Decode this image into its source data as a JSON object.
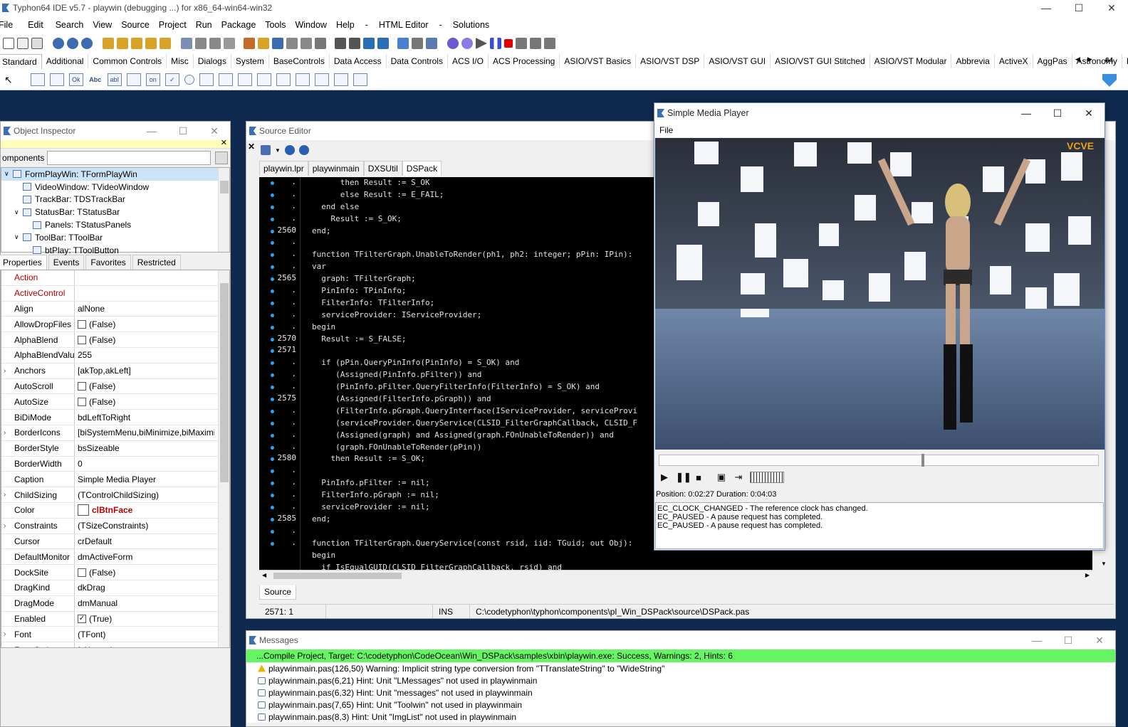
{
  "ide": {
    "title": "Typhon64 IDE v5.7 - playwin (debugging ...) for x86_64-win64-win32",
    "menu": [
      "File",
      "Edit",
      "Search",
      "View",
      "Source",
      "Project",
      "Run",
      "Package",
      "Tools",
      "Window",
      "Help",
      "-",
      "HTML Editor",
      "-",
      "Solutions"
    ],
    "component_tabs": [
      "Standard",
      "Additional",
      "Common Controls",
      "Misc",
      "Dialogs",
      "System",
      "BaseControls",
      "Data Access",
      "Data Controls",
      "ACS I/O",
      "ACS Processing",
      "ASIO/VST Basics",
      "ASIO/VST DSP",
      "ASIO/VST GUI",
      "ASIO/VST GUI Stitched",
      "ASIO/VST Modular",
      "Abbrevia",
      "ActiveX",
      "AggPas",
      "Astronomy",
      "B"
    ],
    "badge": "64",
    "palette_icons": [
      "Ok",
      "Abc",
      "abI",
      "on"
    ]
  },
  "object_inspector": {
    "title": "Object Inspector",
    "filter_label": "omponents",
    "tree": [
      {
        "label": "FormPlayWin: TFormPlayWin",
        "indent": 0,
        "expanded": "v"
      },
      {
        "label": "VideoWindow: TVideoWindow",
        "indent": 1,
        "expanded": ""
      },
      {
        "label": "TrackBar: TDSTrackBar",
        "indent": 1,
        "expanded": ""
      },
      {
        "label": "StatusBar: TStatusBar",
        "indent": 1,
        "expanded": "v"
      },
      {
        "label": "Panels: TStatusPanels",
        "indent": 2,
        "expanded": ""
      },
      {
        "label": "ToolBar: TToolBar",
        "indent": 1,
        "expanded": "v"
      },
      {
        "label": "btPlay: TToolButton",
        "indent": 2,
        "expanded": ""
      }
    ],
    "tabs": [
      "Properties",
      "Events",
      "Favorites",
      "Restricted"
    ],
    "properties": [
      {
        "name": "Action",
        "value": "",
        "red": true
      },
      {
        "name": "ActiveControl",
        "value": "",
        "red": true
      },
      {
        "name": "Align",
        "value": "alNone"
      },
      {
        "name": "AllowDropFiles",
        "value": "(False)",
        "checkbox": "unchecked"
      },
      {
        "name": "AlphaBlend",
        "value": "(False)",
        "checkbox": "unchecked"
      },
      {
        "name": "AlphaBlendValu",
        "value": "255"
      },
      {
        "name": "Anchors",
        "value": "[akTop,akLeft]",
        "expandable": true
      },
      {
        "name": "AutoScroll",
        "value": "(False)",
        "checkbox": "unchecked"
      },
      {
        "name": "AutoSize",
        "value": "(False)",
        "checkbox": "unchecked"
      },
      {
        "name": "BiDiMode",
        "value": "bdLeftToRight"
      },
      {
        "name": "BorderIcons",
        "value": "[biSystemMenu,biMinimize,biMaximi",
        "expandable": true
      },
      {
        "name": "BorderStyle",
        "value": "bsSizeable"
      },
      {
        "name": "BorderWidth",
        "value": "0"
      },
      {
        "name": "Caption",
        "value": "Simple Media Player"
      },
      {
        "name": "ChildSizing",
        "value": "(TControlChildSizing)",
        "expandable": true
      },
      {
        "name": "Color",
        "value": "clBtnFace",
        "swatch": true
      },
      {
        "name": "Constraints",
        "value": "(TSizeConstraints)",
        "expandable": true
      },
      {
        "name": "Cursor",
        "value": "crDefault"
      },
      {
        "name": "DefaultMonitor",
        "value": "dmActiveForm"
      },
      {
        "name": "DockSite",
        "value": "(False)",
        "checkbox": "unchecked"
      },
      {
        "name": "DragKind",
        "value": "dkDrag"
      },
      {
        "name": "DragMode",
        "value": "dmManual"
      },
      {
        "name": "Enabled",
        "value": "(True)",
        "checkbox": "checked"
      },
      {
        "name": "Font",
        "value": "(TFont)",
        "expandable": true
      },
      {
        "name": "FormStyle",
        "value": "fsNormal"
      }
    ]
  },
  "source_editor": {
    "title": "Source Editor",
    "tabs": [
      "playwin.lpr",
      "playwinmain",
      "DXSUtil",
      "DSPack"
    ],
    "gutter": [
      ".",
      ".",
      ".",
      ".",
      "2560",
      ".",
      ".",
      ".",
      "2565",
      ".",
      ".",
      ".",
      ".",
      "2570",
      "2571",
      ".",
      ".",
      ".",
      "2575",
      ".",
      ".",
      ".",
      ".",
      "2580",
      ".",
      ".",
      ".",
      ".",
      "2585",
      ".",
      "."
    ],
    "lines": [
      "      then Result := S_OK",
      "      else Result := E_FAIL;",
      "  end else",
      "    Result := S_OK;",
      "end;",
      "",
      "function TFilterGraph.UnableToRender(ph1, ph2: integer; pPin: IPin):",
      "var",
      "  graph: TFilterGraph;",
      "  PinInfo: TPinInfo;",
      "  FilterInfo: TFilterInfo;",
      "  serviceProvider: IServiceProvider;",
      "begin",
      "  Result := S_FALSE;",
      "",
      "  if (pPin.QueryPinInfo(PinInfo) = S_OK) and",
      "     (Assigned(PinInfo.pFilter)) and",
      "     (PinInfo.pFilter.QueryFilterInfo(FilterInfo) = S_OK) and",
      "     (Assigned(FilterInfo.pGraph)) and",
      "     (FilterInfo.pGraph.QueryInterface(IServiceProvider, serviceProvi",
      "     (serviceProvider.QueryService(CLSID_FilterGraphCallback, CLSID_F",
      "     (Assigned(graph) and Assigned(graph.FOnUnableToRender)) and",
      "     (graph.FOnUnableToRender(pPin))",
      "    then Result := S_OK;",
      "",
      "  PinInfo.pFilter := nil;",
      "  FilterInfo.pGraph := nil;",
      "  serviceProvider := nil;",
      "end;",
      "",
      "function TFilterGraph.QueryService(const rsid, iid: TGuid; out Obj):",
      "begin",
      "  if IsEqualGUID(CLSID_FilterGraphCallback, rsid) and"
    ],
    "source_tab": "Source",
    "status": {
      "pos": "2571:  1",
      "mode": "INS",
      "path": "C:\\codetyphon\\typhon\\components\\pl_Win_DSPack\\source\\DSPack.pas"
    }
  },
  "media_player": {
    "title": "Simple Media Player",
    "menu": "File",
    "position_text": "Position: 0:02:27 Duration: 0:04:03",
    "progress": 0.6,
    "log": [
      "EC_CLOCK_CHANGED - The reference clock has changed.",
      "EC_PAUSED - A pause request has completed.",
      "EC_PAUSED - A pause request has completed."
    ],
    "video_watermark": "VCVE"
  },
  "messages": {
    "title": "Messages",
    "header": "...Compile Project, Target: C:\\codetyphon\\CodeOcean\\Win_DSPack\\samples\\xbin\\playwin.exe: Success, Warnings: 2, Hints: 6",
    "lines": [
      {
        "icon": "warning",
        "text": "playwinmain.pas(126,50) Warning: Implicit string type conversion from \"TTranslateString\" to \"WideString\""
      },
      {
        "icon": "hint",
        "text": "playwinmain.pas(6,21) Hint: Unit \"LMessages\" not used in playwinmain"
      },
      {
        "icon": "hint",
        "text": "playwinmain.pas(6,32) Hint: Unit \"messages\" not used in playwinmain"
      },
      {
        "icon": "hint",
        "text": "playwinmain.pas(7,65) Hint: Unit \"Toolwin\" not used in playwinmain"
      },
      {
        "icon": "hint",
        "text": "playwinmain.pas(8,3) Hint: Unit \"ImgList\" not used in playwinmain"
      }
    ]
  },
  "colors": {
    "accent": "#3a6fb3",
    "green_bar": "#66f562",
    "code_bg": "#000000",
    "gutter_dot": "#22a7ff"
  }
}
